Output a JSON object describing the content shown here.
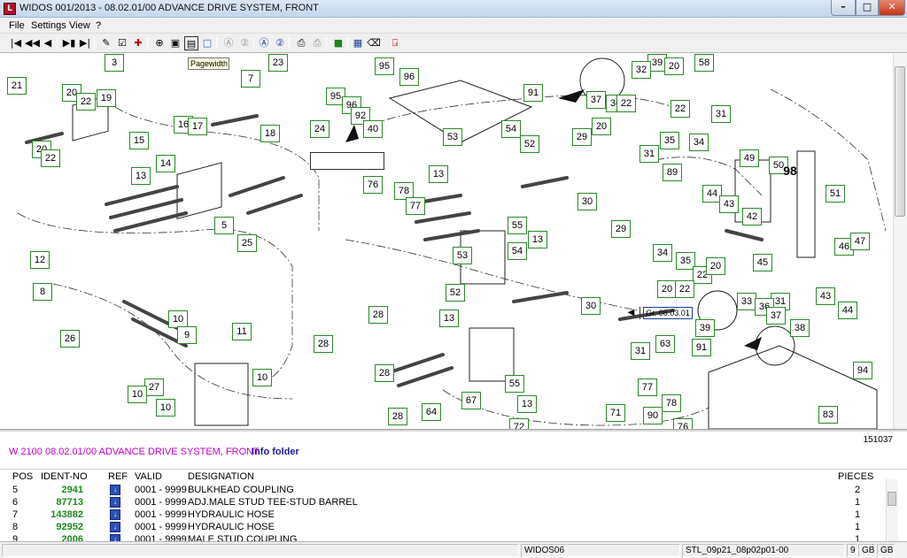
{
  "window": {
    "title": "WIDOS 001/2013 - 08.02.01/00 ADVANCE DRIVE SYSTEM, FRONT",
    "app_icon": "L",
    "minimize": "–",
    "maximize": "□",
    "close": "✕"
  },
  "menu": [
    "File",
    "Settings",
    "View",
    "?"
  ],
  "toolbar": {
    "tooltip": "Pagewidth",
    "icons": [
      "first-page-icon",
      "previous-page-icon",
      "back-icon",
      "forward-icon",
      "page-next-icon",
      "page-last-icon",
      "note-icon",
      "note-edit-icon",
      "add-red-cross-icon",
      "zoom-icon",
      "page-fit-icon",
      "pagewidth-icon",
      "zoom-window-icon",
      "zoom-1-icon",
      "zoom-2-icon",
      "annotation-1-icon",
      "annotation-2-icon",
      "print-icon",
      "print-preview-icon",
      "export-icon",
      "select-icon",
      "eraser-icon",
      "exit-icon"
    ]
  },
  "drawing": {
    "reference_label": "Gr. 08.03.01",
    "callouts": [
      {
        "n": "3"
      },
      {
        "n": "23"
      },
      {
        "n": "95"
      },
      {
        "n": "96"
      },
      {
        "n": "39"
      },
      {
        "n": "20"
      },
      {
        "n": "58"
      },
      {
        "n": "7"
      },
      {
        "n": "21"
      },
      {
        "n": "20"
      },
      {
        "n": "22"
      },
      {
        "n": "19"
      },
      {
        "n": "95"
      },
      {
        "n": "96"
      },
      {
        "n": "92"
      },
      {
        "n": "91"
      },
      {
        "n": "32"
      },
      {
        "n": "37"
      },
      {
        "n": "36"
      },
      {
        "n": "22"
      },
      {
        "n": "22"
      },
      {
        "n": "31"
      },
      {
        "n": "16"
      },
      {
        "n": "17"
      },
      {
        "n": "18"
      },
      {
        "n": "24"
      },
      {
        "n": "40"
      },
      {
        "n": "54"
      },
      {
        "n": "20"
      },
      {
        "n": "35"
      },
      {
        "n": "15"
      },
      {
        "n": "20"
      },
      {
        "n": "22"
      },
      {
        "n": "53"
      },
      {
        "n": "52"
      },
      {
        "n": "29"
      },
      {
        "n": "31"
      },
      {
        "n": "34"
      },
      {
        "n": "14"
      },
      {
        "n": "89"
      },
      {
        "n": "49"
      },
      {
        "n": "50"
      },
      {
        "n": "98"
      },
      {
        "n": "13"
      },
      {
        "n": "13"
      },
      {
        "n": "76"
      },
      {
        "n": "78"
      },
      {
        "n": "77"
      },
      {
        "n": "30"
      },
      {
        "n": "44"
      },
      {
        "n": "43"
      },
      {
        "n": "51"
      },
      {
        "n": "42"
      },
      {
        "n": "5"
      },
      {
        "n": "55"
      },
      {
        "n": "29"
      },
      {
        "n": "13"
      },
      {
        "n": "46"
      },
      {
        "n": "47"
      },
      {
        "n": "25"
      },
      {
        "n": "53"
      },
      {
        "n": "54"
      },
      {
        "n": "34"
      },
      {
        "n": "35"
      },
      {
        "n": "22"
      },
      {
        "n": "20"
      },
      {
        "n": "45"
      },
      {
        "n": "12"
      },
      {
        "n": "8"
      },
      {
        "n": "52"
      },
      {
        "n": "20"
      },
      {
        "n": "22"
      },
      {
        "n": "31"
      },
      {
        "n": "43"
      },
      {
        "n": "33"
      },
      {
        "n": "36"
      },
      {
        "n": "44"
      },
      {
        "n": "10"
      },
      {
        "n": "28"
      },
      {
        "n": "30"
      },
      {
        "n": "13"
      },
      {
        "n": "37"
      },
      {
        "n": "39"
      },
      {
        "n": "38"
      },
      {
        "n": "26"
      },
      {
        "n": "9"
      },
      {
        "n": "11"
      },
      {
        "n": "28"
      },
      {
        "n": "63"
      },
      {
        "n": "31"
      },
      {
        "n": "91"
      },
      {
        "n": "10"
      },
      {
        "n": "28"
      },
      {
        "n": "27"
      },
      {
        "n": "55"
      },
      {
        "n": "77"
      },
      {
        "n": "78"
      },
      {
        "n": "94"
      },
      {
        "n": "10"
      },
      {
        "n": "10"
      },
      {
        "n": "67"
      },
      {
        "n": "13"
      },
      {
        "n": "64"
      },
      {
        "n": "28"
      },
      {
        "n": "71"
      },
      {
        "n": "90"
      },
      {
        "n": "83"
      },
      {
        "n": "72"
      },
      {
        "n": "76"
      }
    ]
  },
  "info": {
    "image_number": "151037",
    "assembly_title": "W 2100  08.02.01/00 ADVANCE DRIVE SYSTEM, FRONT",
    "info_link": "Info folder"
  },
  "table": {
    "headers": {
      "pos": "POS",
      "ident": "IDENT-NO",
      "ref": "REF",
      "valid": "VALID",
      "designation": "DESIGNATION",
      "pieces": "PIECES"
    },
    "rows": [
      {
        "pos": "5",
        "ident": "2941",
        "valid": "0001 - 9999",
        "designation": "BULKHEAD COUPLING",
        "pieces": "2"
      },
      {
        "pos": "6",
        "ident": "87713",
        "valid": "0001 - 9999",
        "designation": "ADJ.MALE STUD TEE-STUD BARREL",
        "pieces": "1"
      },
      {
        "pos": "7",
        "ident": "143882",
        "valid": "0001 - 9999",
        "designation": "HYDRAULIC HOSE",
        "pieces": "1"
      },
      {
        "pos": "8",
        "ident": "92952",
        "valid": "0001 - 9999",
        "designation": "HYDRAULIC HOSE",
        "pieces": "1"
      },
      {
        "pos": "9",
        "ident": "2006",
        "valid": "0001 - 9999",
        "designation": "MALE STUD COUPLING",
        "pieces": "1"
      }
    ]
  },
  "status": {
    "s1": "WIDOS06",
    "s2": "STL_09p21_08p02p01-00",
    "s3": "9",
    "s4": "GB",
    "s5": "GB"
  }
}
